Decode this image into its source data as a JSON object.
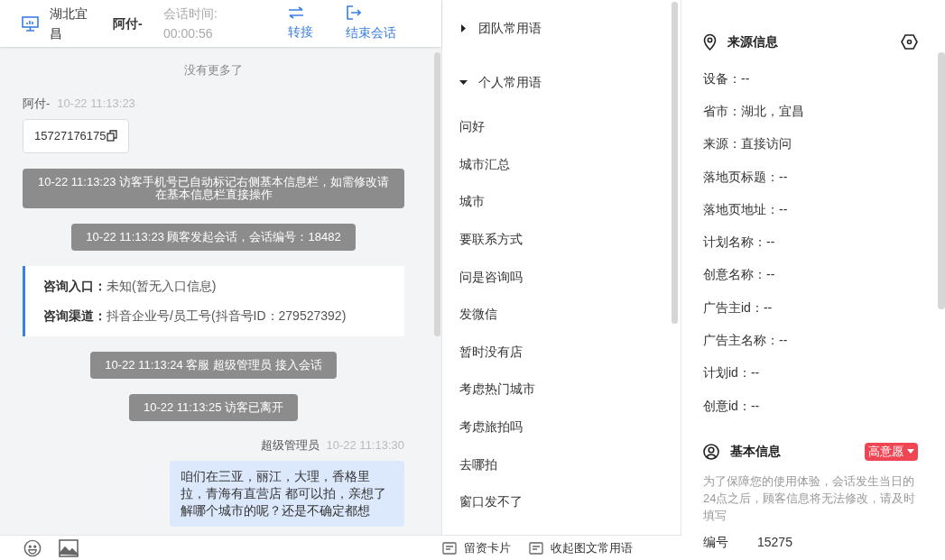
{
  "header": {
    "location": "湖北宜昌",
    "visitor": "阿付-",
    "timer_label": "会话时间:",
    "timer_value": "00:00:56",
    "actions": [
      {
        "kind": "transfer",
        "label": "转接"
      },
      {
        "kind": "end",
        "label": "结束会话"
      }
    ]
  },
  "chat": {
    "no_more": "没有更多了",
    "messages": [
      {
        "kind": "visitor",
        "sender": "阿付-",
        "time": "10-22 11:13:23",
        "text": "15727176175"
      },
      {
        "kind": "system",
        "text": "10-22 11:13:23 访客手机号已自动标记右侧基本信息栏，如需修改请在基本信息栏直接操作"
      },
      {
        "kind": "system",
        "text": "10-22 11:13:23 顾客发起会话，会话编号：18482"
      },
      {
        "kind": "info",
        "rows": [
          {
            "label": "咨询入口：",
            "value": "未知(暂无入口信息)"
          },
          {
            "label": "咨询渠道：",
            "value": "抖音企业号/员工号(抖音号ID：279527392)"
          }
        ]
      },
      {
        "kind": "system",
        "text": "10-22 11:13:24 客服 超级管理员 接入会话"
      },
      {
        "kind": "system",
        "text": "10-22 11:13:25 访客已离开"
      },
      {
        "kind": "agent",
        "sender": "超级管理员",
        "time": "10-22 11:13:30",
        "text": "咱们在三亚，丽江，大理，香格里拉，青海有直营店 都可以拍，亲想了解哪个城市的呢？还是不确定都想"
      }
    ]
  },
  "phrases": {
    "groups": [
      {
        "label": "团队常用语",
        "expanded": false
      },
      {
        "label": "个人常用语",
        "expanded": true,
        "items": [
          "问好",
          "城市汇总",
          "城市",
          "要联系方式",
          "问是咨询吗",
          "发微信",
          "暂时没有店",
          "考虑热门城市",
          "考虑旅拍吗",
          "去哪拍",
          "窗口发不了"
        ]
      }
    ]
  },
  "bottom_bar": {
    "actions": [
      "留资卡片",
      "收起图文常用语"
    ]
  },
  "source_info": {
    "title": "来源信息",
    "rows": [
      "设备：--",
      "省市：湖北，宜昌",
      "来源：直接访问",
      "落地页标题：--",
      "落地页地址：--",
      "计划名称：--",
      "创意名称：--",
      "广告主id：--",
      "广告主名称：--",
      "计划id：--",
      "创意id：--"
    ]
  },
  "basic_info": {
    "title": "基本信息",
    "intent": "高意愿",
    "notice": "为了保障您的使用体验，会话发生当日的24点之后，顾客信息将无法修改，请及时填写",
    "fields": [
      {
        "label": "编号",
        "value": "15275"
      }
    ]
  }
}
